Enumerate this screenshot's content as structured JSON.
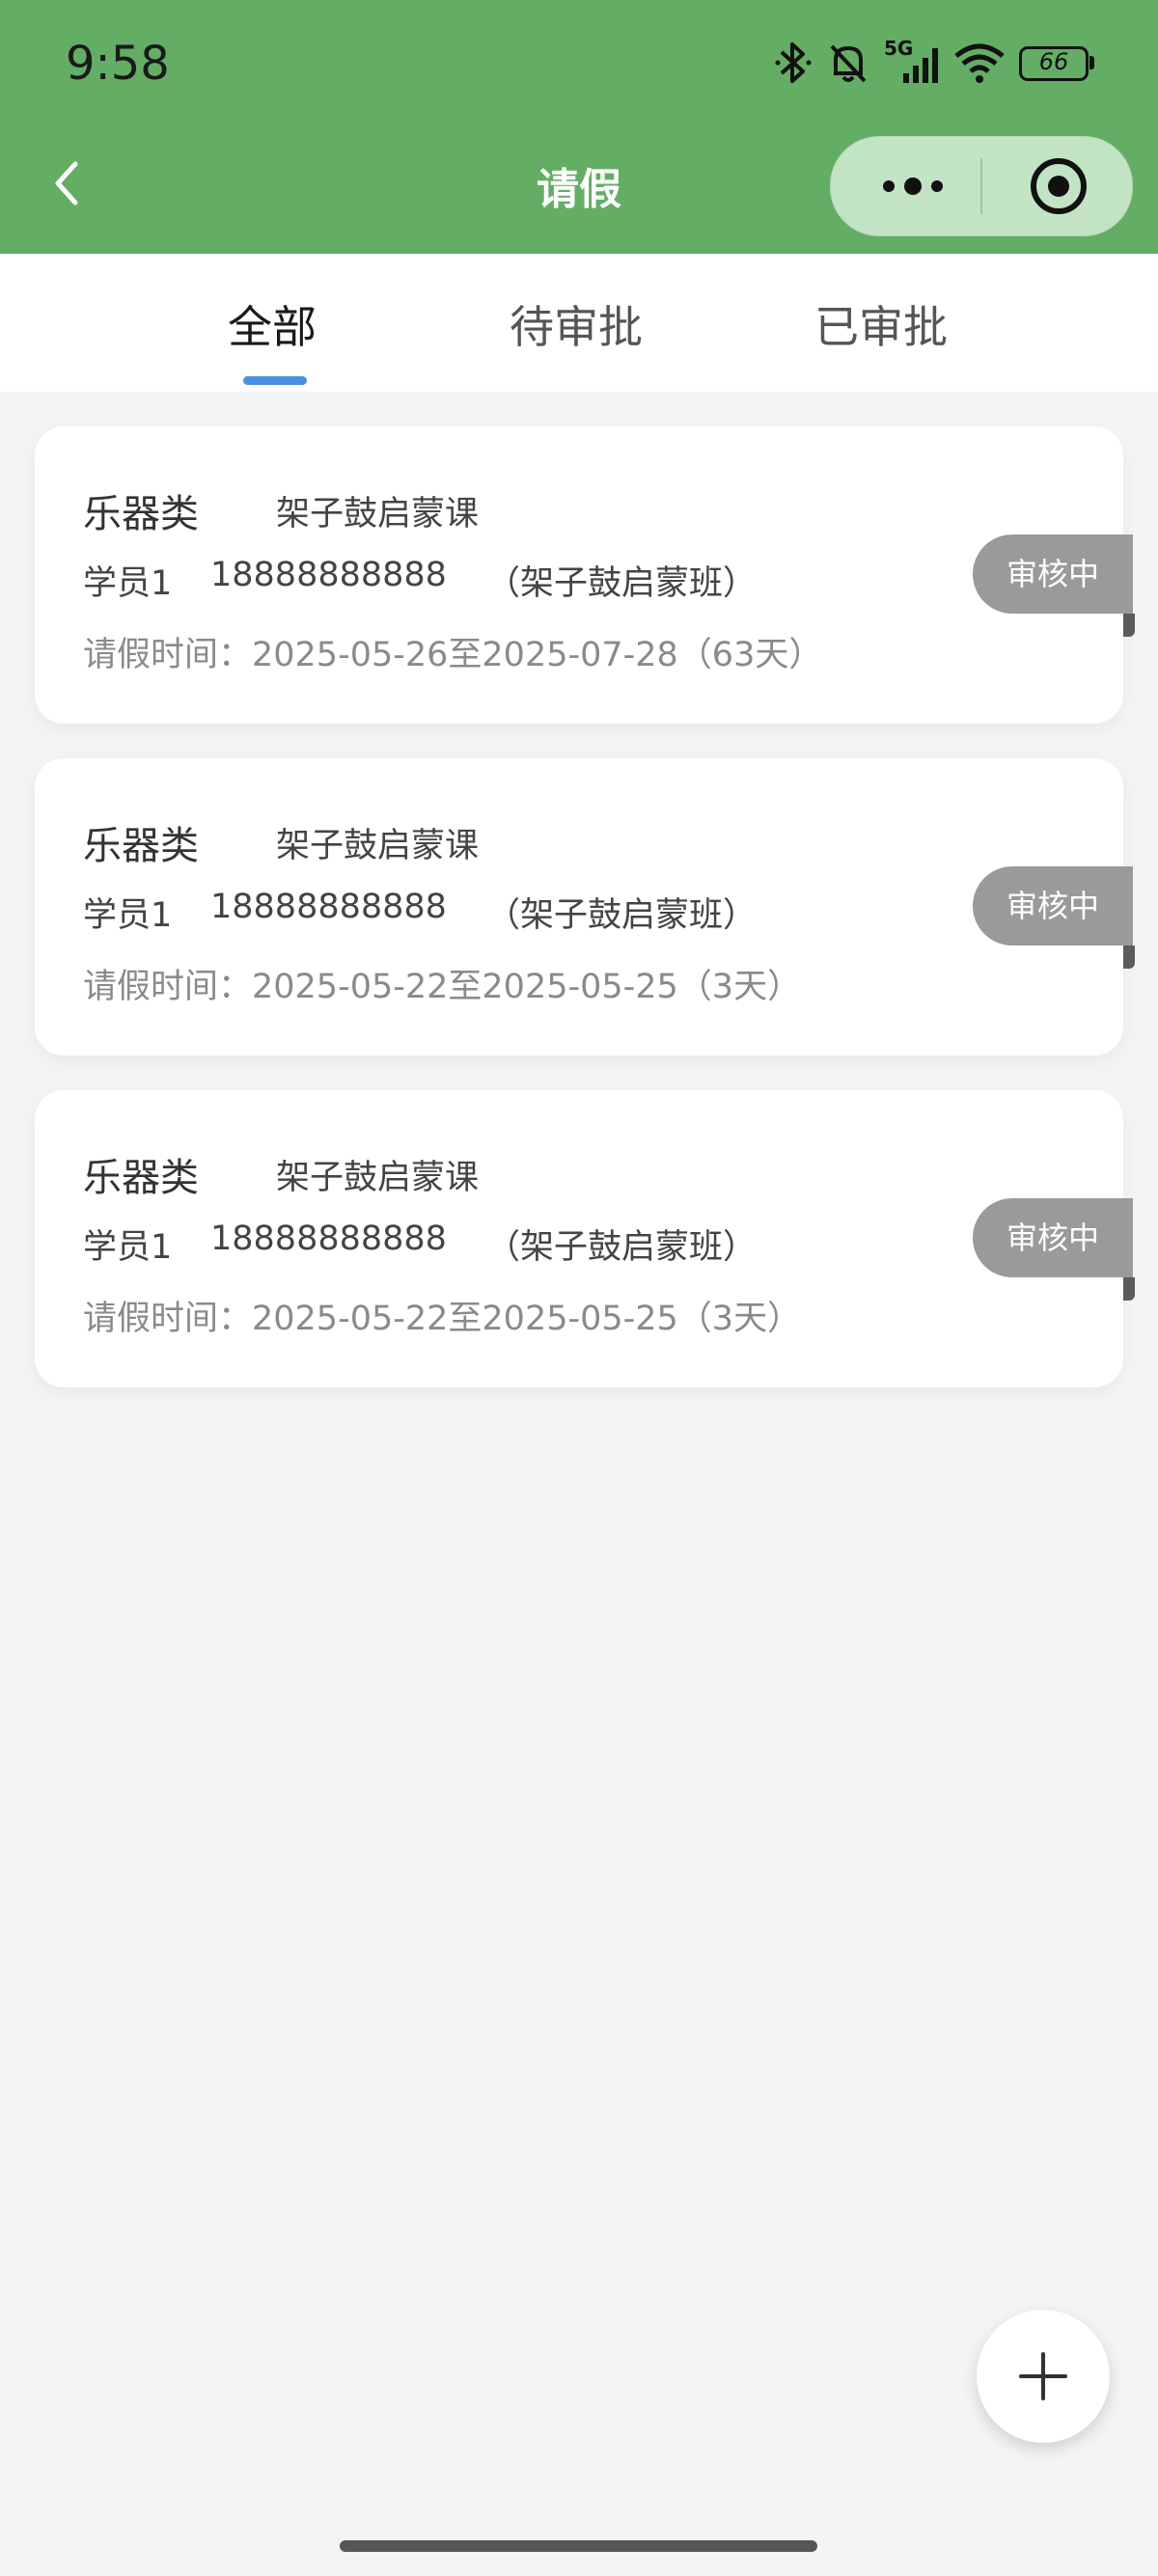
{
  "status_bar": {
    "time": "9:58",
    "network": "5G",
    "battery": "66",
    "icons": [
      "bluetooth-icon",
      "mute-bell-icon",
      "signal-icon",
      "wifi-icon",
      "battery-icon"
    ]
  },
  "nav": {
    "title": "请假",
    "back_icon": "chevron-left-icon",
    "more_icon": "more-dots-icon",
    "close_icon": "target-circle-icon"
  },
  "tabs": [
    {
      "label": "全部",
      "active": true
    },
    {
      "label": "待审批",
      "active": false
    },
    {
      "label": "已审批",
      "active": false
    }
  ],
  "leaves": [
    {
      "category": "乐器类",
      "course": "架子鼓启蒙课",
      "student": "学员1",
      "phone": "18888888888",
      "class": "（架子鼓启蒙班）",
      "leave_time": "请假时间：2025-05-26至2025-07-28（63天）",
      "status": "审核中"
    },
    {
      "category": "乐器类",
      "course": "架子鼓启蒙课",
      "student": "学员1",
      "phone": "18888888888",
      "class": "（架子鼓启蒙班）",
      "leave_time": "请假时间：2025-05-22至2025-05-25（3天）",
      "status": "审核中"
    },
    {
      "category": "乐器类",
      "course": "架子鼓启蒙课",
      "student": "学员1",
      "phone": "18888888888",
      "class": "（架子鼓启蒙班）",
      "leave_time": "请假时间：2025-05-22至2025-05-25（3天）",
      "status": "审核中"
    }
  ],
  "fab": {
    "icon": "plus-icon"
  },
  "colors": {
    "header": "#64ad65",
    "tab_indicator": "#4a90e2",
    "badge": "#9a9a9a",
    "background": "#f3f4f6"
  }
}
